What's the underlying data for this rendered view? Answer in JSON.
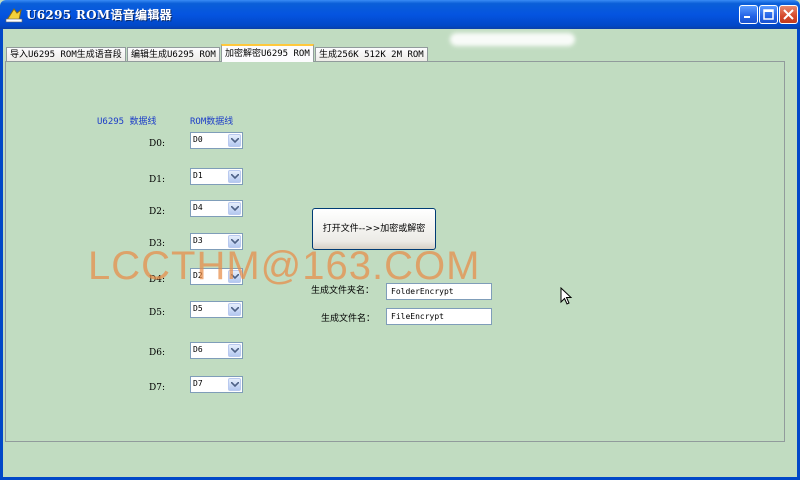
{
  "window": {
    "title": "U6295 ROM语音编辑器"
  },
  "tabs": [
    {
      "label": "导入U6295 ROM生成语音段",
      "active": false
    },
    {
      "label": "编辑生成U6295 ROM",
      "active": false
    },
    {
      "label": "加密解密U6295 ROM",
      "active": true
    },
    {
      "label": "生成256K 512K 2M ROM",
      "active": false
    }
  ],
  "mapping": {
    "header_left": "U6295 数据线",
    "header_right": "ROM数据线",
    "rows": [
      {
        "label": "D0:",
        "value": "D0"
      },
      {
        "label": "D1:",
        "value": "D1"
      },
      {
        "label": "D2:",
        "value": "D4"
      },
      {
        "label": "D3:",
        "value": "D3"
      },
      {
        "label": "D4:",
        "value": "D2"
      },
      {
        "label": "D5:",
        "value": "D5"
      },
      {
        "label": "D6:",
        "value": "D6"
      },
      {
        "label": "D7:",
        "value": "D7"
      }
    ]
  },
  "actions": {
    "open_button": "打开文件-->>加密或解密"
  },
  "output": {
    "folder_label": "生成文件夹名：",
    "folder_value": "FolderEncrypt",
    "file_label": "生成文件名：",
    "file_value": "FileEncrypt"
  },
  "watermark": "LCCTHM@163.COM",
  "colors": {
    "background": "#c1dcc1",
    "titlebar": "#0554e0",
    "header_text": "#1c3cc8",
    "watermark": "#e88c46"
  }
}
